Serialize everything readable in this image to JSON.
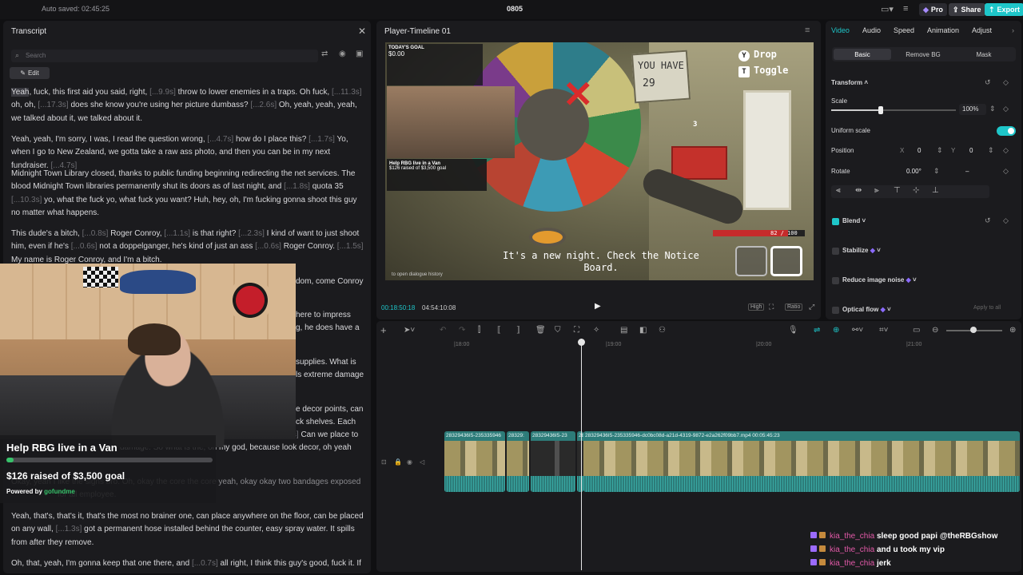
{
  "topbar": {
    "autosave": "Auto saved: 02:45:25",
    "project": "0805",
    "pro_label": "Pro",
    "share_label": "Share",
    "export_label": "Export"
  },
  "transcript": {
    "title": "Transcript",
    "search_placeholder": "Search",
    "edit_label": "Edit",
    "paragraphs": [
      [
        {
          "t": "Yeah"
        },
        {
          "t": ", fuck, this first aid you said, right, "
        },
        {
          "t": "[...9.9s]",
          "p": 1
        },
        {
          "t": " throw to lower enemies in a traps. Oh fuck, "
        },
        {
          "t": "[...11.3s]",
          "p": 1
        },
        {
          "t": " oh, oh, "
        },
        {
          "t": "[...17.3s]",
          "p": 1
        },
        {
          "t": " does she know you're using her picture dumbass? "
        },
        {
          "t": "[...2.6s]",
          "p": 1
        },
        {
          "t": " Oh, yeah, yeah, yeah, we talked about it, we talked about it."
        }
      ],
      [
        {
          "t": "Yeah, yeah, I'm sorry, I was, I read the question wrong, "
        },
        {
          "t": "[...4.7s]",
          "p": 1
        },
        {
          "t": " how do I place this? "
        },
        {
          "t": "[...1.7s]",
          "p": 1
        },
        {
          "t": " Yo, when I go to New Zealand, we gotta take a raw ass photo, and then you can be in my next fundraiser. "
        },
        {
          "t": "[...4.7s]",
          "p": 1
        }
      ],
      [
        {
          "t": "Midnight Town Library closed, thanks to public funding beginning redirecting the net services. The blood Midnight Town libraries permanently shut its doors as of last night, and "
        },
        {
          "t": "[...1.8s]",
          "p": 1
        },
        {
          "t": " quota 35 "
        },
        {
          "t": "[...10.3s]",
          "p": 1
        },
        {
          "t": " yo, what the fuck yo, what fuck you want? Huh, hey, oh, I'm fucking gonna shoot this guy no matter what happens."
        }
      ],
      [
        {
          "t": "This dude's a bitch, "
        },
        {
          "t": "[...0.8s]",
          "p": 1
        },
        {
          "t": " Roger Conroy, "
        },
        {
          "t": "[...1.1s]",
          "p": 1
        },
        {
          "t": " is that right? "
        },
        {
          "t": "[...2.3s]",
          "p": 1
        },
        {
          "t": " I kind of want to just shoot him, even if he's "
        },
        {
          "t": "[...0.6s]",
          "p": 1
        },
        {
          "t": " not a doppelganger, he's kind of just an ass "
        },
        {
          "t": "[...0.6s]",
          "p": 1
        },
        {
          "t": " Roger Conroy. "
        },
        {
          "t": "[...1.5s]",
          "p": 1
        },
        {
          "t": " My name is Roger Conroy, and I'm a bitch."
        }
      ]
    ],
    "hidden_frags": [
      "dom, come Conroy",
      "here to impress",
      "g, he does have a",
      "supplies. What is",
      "ls extreme damage",
      "e decor points, can",
      "ck shelves. Each"
    ],
    "p5": [
      {
        "t": "box contains 15 four signs placed above each aisle, plus 20 decor points. "
      },
      {
        "t": "[...1.1s]",
        "p": 1
      },
      {
        "t": " Can we place to"
      }
    ],
    "p5b": "damage. So what is the, oh my god, because look decor, oh yeah our",
    "p6a": "Okay, yeah I like the signs bro. Oh, okay the core the core yeah, okay okay two bandages exposed",
    "p6b": "for all employee.",
    "p7": [
      {
        "t": "Yeah, that's, that's it, that's the most no brainer one, can place anywhere on the floor, can be placed on any wall, "
      },
      {
        "t": "[...1.3s]",
        "p": 1
      },
      {
        "t": " got a permanent hose installed behind the counter, easy spray water. It spills from after they remove."
      }
    ],
    "p8": [
      {
        "t": "Oh, that, yeah, I'm gonna keep that one there, and "
      },
      {
        "t": "[...0.7s]",
        "p": 1
      },
      {
        "t": " all right, I think this guy's good, fuck it. If"
      }
    ]
  },
  "overlay": {
    "title": "Help RBG live in a Van",
    "raised": "$126 raised of $3,500 goal",
    "powered": "Powered by",
    "brand": "gofundme",
    "progress": 0.036
  },
  "player": {
    "title": "Player-Timeline 01",
    "current_time": "00:18:50:18",
    "total_time": "04:54:10:08",
    "ctl_high": "High",
    "ctl_ratio": "Ratio",
    "hud_drop": "Drop",
    "hud_toggle": "Toggle",
    "hud_key_y": "Y",
    "hud_key_t": "T",
    "sign_line1": "YOU HAVE",
    "sign_line2": "29",
    "box_count": "3",
    "subtitle": "It's a new night. Check the Notice Board.",
    "hp": "82 / 100",
    "hp_fraction": 0.82,
    "dialogue_hint": "to open dialogue history",
    "today_label": "TODAY'S GOAL",
    "goal_amt": "$0.00",
    "video_donate_title": "Help RBG live in a Van",
    "video_donate_raised": "$126 raised of $3,500 goal"
  },
  "props": {
    "tabs": [
      "Video",
      "Audio",
      "Speed",
      "Animation",
      "Adjust"
    ],
    "seg": [
      "Basic",
      "Remove BG",
      "Mask"
    ],
    "transform": "Transform",
    "scale": "Scale",
    "scale_val": "100%",
    "scale_fraction": 0.4,
    "uniform": "Uniform scale",
    "position": "Position",
    "x_label": "X",
    "x_val": "0",
    "y_label": "Y",
    "y_val": "0",
    "rotate": "Rotate",
    "rotate_val": "0.00°",
    "rotate_dash": "–",
    "blend": "Blend",
    "stabilize": "Stabilize",
    "reduce_noise": "Reduce image noise",
    "optical_flow": "Optical flow",
    "apply_all": "Apply to all"
  },
  "timeline": {
    "ticks": [
      "|18:00",
      "|19:00",
      "|20:00",
      "|21:00"
    ],
    "clips": [
      "28329436I5-235335946",
      "28329:",
      "28329436I5-23",
      "28",
      "28329436I5-235335946-dc0bc08d-a21d-4319-9872-e2a262f09bb7.mp4   00:05:45:23"
    ]
  },
  "chat": [
    {
      "user": "kia_the_chia",
      "msg": "sleep good papi @theRBGshow"
    },
    {
      "user": "kia_the_chia",
      "msg": "and u took my vip"
    },
    {
      "user": "kia_the_chia",
      "msg": "jerk"
    }
  ],
  "colors": {
    "accent": "#1ec6c9",
    "pro": "#7c5cff",
    "gofundme": "#37c26a"
  }
}
